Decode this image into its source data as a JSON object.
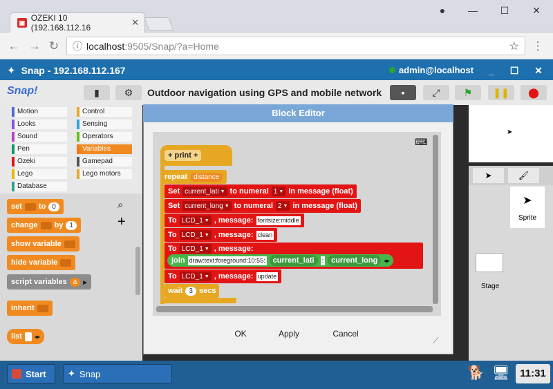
{
  "browser": {
    "tab_title": "OZEKI 10 (192.168.112.16",
    "url_host": "localhost",
    "url_path": ":9505/Snap/?a=Home"
  },
  "app": {
    "title": "Snap - 192.168.112.167",
    "user": "admin@localhost",
    "logo": "Snap!",
    "project": "Outdoor navigation using GPS and mobile network"
  },
  "categories": [
    {
      "label": "Motion",
      "color": "#4a6cd4"
    },
    {
      "label": "Control",
      "color": "#e6a822"
    },
    {
      "label": "Looks",
      "color": "#8a55d7"
    },
    {
      "label": "Sensing",
      "color": "#2ca5e2"
    },
    {
      "label": "Sound",
      "color": "#bb42c3"
    },
    {
      "label": "Operators",
      "color": "#62c213"
    },
    {
      "label": "Pen",
      "color": "#0e9a6c"
    },
    {
      "label": "Variables",
      "color": "#f3761d"
    },
    {
      "label": "Ozeki",
      "color": "#e31414"
    },
    {
      "label": "Gamepad",
      "color": "#555555"
    },
    {
      "label": "Lego",
      "color": "#e6b800"
    },
    {
      "label": "Lego motors",
      "color": "#e6a822"
    },
    {
      "label": "Database",
      "color": "#2aa090"
    }
  ],
  "palette": {
    "set": "set",
    "to": "to",
    "set_val": "0",
    "change": "change",
    "by": "by",
    "change_val": "1",
    "show": "show variable",
    "hide": "hide variable",
    "script": "script variables",
    "script_var": "a",
    "inherit": "inherit",
    "list": "list"
  },
  "dialog": {
    "title": "Block Editor",
    "ok": "OK",
    "apply": "Apply",
    "cancel": "Cancel"
  },
  "script": {
    "hat": "+ print +",
    "repeat": "repeat",
    "repeat_var": "distance",
    "set1_kw": "Set",
    "set1_var": "current_lati",
    "set1_mid": "to numeral",
    "set1_num": "1",
    "set1_end": "in message (float)",
    "set2_kw": "Set",
    "set2_var": "current_long",
    "set2_mid": "to numeral",
    "set2_num": "2",
    "set2_end": "in message (float)",
    "to_kw": "To",
    "lcd": "LCD_1",
    "msg": ", message:",
    "m1": "fontsize:middle",
    "m2": "clean",
    "join": "join",
    "join_txt": "draw:text:foreground:10:55:",
    "j_lati": "current_lati",
    "j_sep": ":",
    "j_long": "current_long",
    "m4": "update",
    "wait": "wait",
    "wait_val": "3",
    "secs": "secs"
  },
  "stage": {
    "sprite": "Sprite",
    "stage": "Stage"
  },
  "taskbar": {
    "start": "Start",
    "task": "Snap",
    "clock": "11:31"
  }
}
